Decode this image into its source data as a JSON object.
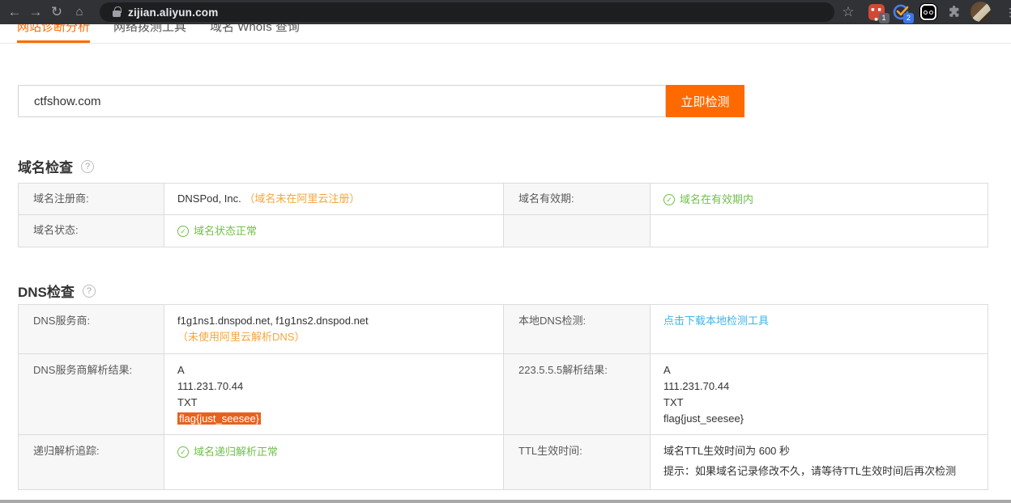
{
  "browser": {
    "url": "zijian.aliyun.com",
    "extension_badges": {
      "red": "1",
      "checker": "2"
    }
  },
  "icons": {
    "back": "←",
    "forward": "→",
    "reload": "↻",
    "home": "⌂",
    "star": "☆",
    "menu": "⋮",
    "help": "?",
    "check": "✓",
    "ext_red_dots": "■ ■ ■"
  },
  "nav": {
    "tabs": [
      {
        "label": "网站诊断分析"
      },
      {
        "label": "网络拨测工具"
      },
      {
        "label": "域名 WhoIs 查询"
      }
    ]
  },
  "search": {
    "value": "ctfshow.com",
    "button_label": "立即检测"
  },
  "domain_check": {
    "title": "域名检查",
    "registrar_label": "域名注册商:",
    "registrar_value": "DNSPod, Inc.",
    "registrar_warning": "（域名未在阿里云注册）",
    "validity_label": "域名有效期:",
    "validity_status": "域名在有效期内",
    "status_label": "域名状态:",
    "status_value": "域名状态正常"
  },
  "dns_check": {
    "title": "DNS检查",
    "provider_label": "DNS服务商:",
    "provider_value": "f1g1ns1.dnspod.net, f1g1ns2.dnspod.net",
    "provider_warning": "（未使用阿里云解析DNS）",
    "local_dns_label": "本地DNS检测:",
    "local_dns_link": "点击下载本地检测工具",
    "provider_result_label": "DNS服务商解析结果:",
    "provider_result_lines": [
      "A",
      "111.231.70.44",
      "TXT"
    ],
    "provider_result_flag": "flag{just_seesee}",
    "public_result_label": "223.5.5.5解析结果:",
    "public_result_lines": [
      "A",
      "111.231.70.44",
      "TXT",
      "flag{just_seesee}"
    ],
    "recursive_label": "递归解析追踪:",
    "recursive_status": "域名递归解析正常",
    "ttl_label": "TTL生效时间:",
    "ttl_value": "域名TTL生效时间为 600 秒",
    "ttl_hint": "提示：如果域名记录修改不久，请等待TTL生效时间后再次检测"
  },
  "colors": {
    "accent_orange": "#ff6a00",
    "warning_orange": "#f5a63b",
    "success_green": "#71c04a",
    "link_blue": "#3db5e6",
    "selection_highlight": "#e8611d"
  }
}
